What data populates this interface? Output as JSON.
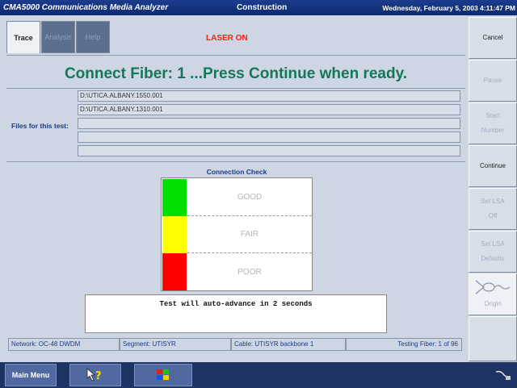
{
  "titlebar": {
    "app_title": "CMA5000 Communications Media Analyzer",
    "mode": "Construction",
    "datetime": "Wednesday, February 5, 2003 4:11:47 PM"
  },
  "tabs": [
    {
      "label": "Trace",
      "active": true
    },
    {
      "label": "Analysis",
      "active": false
    },
    {
      "label": "Help",
      "active": false
    }
  ],
  "laser_status": "LASER ON",
  "prompt": "Connect Fiber:  1    ...Press Continue when ready.",
  "files": {
    "label": "Files for this test:",
    "rows": [
      "D:\\UTICA.ALBANY.1550.001",
      "D:\\UTICA.ALBANY.1310.001",
      "",
      "",
      ""
    ]
  },
  "connection_check": {
    "title": "Connection Check",
    "levels": [
      "GOOD",
      "FAIR",
      "POOR"
    ],
    "colors": [
      "#00e000",
      "#ffff00",
      "#ff0000"
    ]
  },
  "advance_message": "Test will auto-advance in 2 seconds",
  "status": {
    "network": "Network: OC-48 DWDM",
    "segment": "Segment: UTISYR",
    "cable": "Cable: UTISYR backbone 1",
    "testing": "Testing Fiber: 1 of 96"
  },
  "sidebar": {
    "cancel": "Cancel",
    "pause": "Pause",
    "start_line1": "Start",
    "start_line2": "Number",
    "continue": "Continue",
    "setlsa_line1": "Set LSA",
    "setlsa_line2": "Off",
    "defaults_line1": "Set LSA",
    "defaults_line2": "Defaults",
    "origin": "Origin"
  },
  "taskbar": {
    "main_menu": "Main Menu",
    "help_icon": "pointer-question-icon",
    "windows_icon": "windows-flag-icon",
    "tray_icon": "connector-icon"
  }
}
